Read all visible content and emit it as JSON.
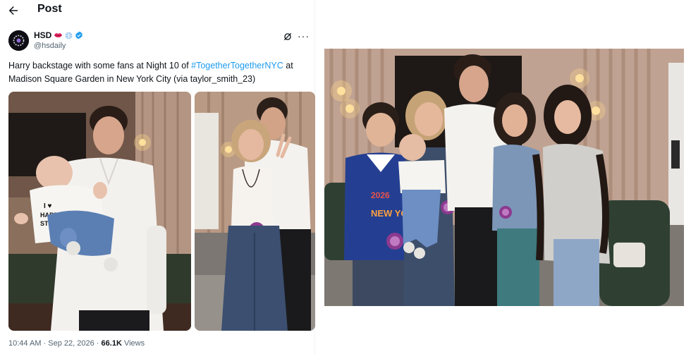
{
  "header": {
    "title": "Post",
    "back_icon": "arrow-left-icon"
  },
  "author": {
    "name": "HSD",
    "handle": "@hsdaily",
    "badges": [
      "lips-emoji-icon",
      "globe-emoji-icon",
      "verified-badge-icon"
    ],
    "avatar_icon": "hsd-avatar",
    "grok_icon": "grok-icon",
    "more_icon": "more-icon"
  },
  "tweet": {
    "text_before": "Harry backstage with some fans at Night 10 of ",
    "hashtag": "#TogetherTogetherNYC",
    "text_after": " at Madison Square Garden in New York City (via taylor_smith_23)"
  },
  "photos": [
    {
      "id": "photo-1",
      "shirt_text": "I ♥ HARRY STYLES"
    },
    {
      "id": "photo-2"
    },
    {
      "id": "photo-3",
      "jersey_text": "2026",
      "jersey_text_2": "NEW YO"
    }
  ],
  "meta": {
    "time": "10:44 AM",
    "separator": "·",
    "date": "Sep 22, 2026",
    "views_count": "66.1K",
    "views_label": "Views"
  },
  "colors": {
    "accent": "#1d9bf0",
    "text": "#0f1419",
    "muted": "#536471"
  }
}
